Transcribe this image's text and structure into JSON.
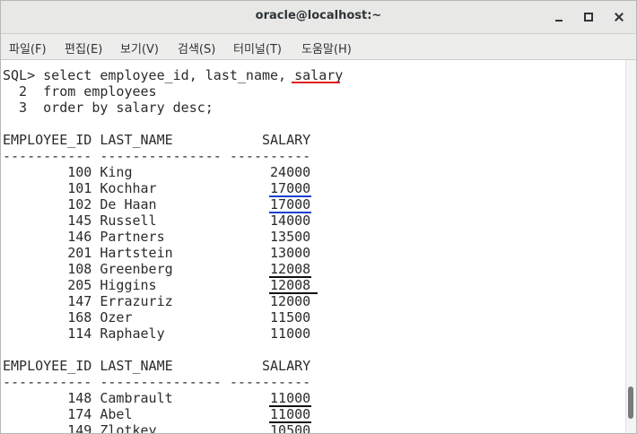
{
  "window": {
    "title": "oracle@localhost:~"
  },
  "menu": [
    "파일(F)",
    "편집(E)",
    "보기(V)",
    "검색(S)",
    "터미널(T)",
    "도움말(H)"
  ],
  "terminal": {
    "lines": [
      "SQL> select employee_id, last_name, salary",
      "  2  from employees",
      "  3  order by salary desc;",
      "",
      "EMPLOYEE_ID LAST_NAME           SALARY",
      "----------- --------------- ----------",
      "        100 King                 24000",
      "        101 Kochhar              17000",
      "        102 De Haan              17000",
      "        145 Russell              14000",
      "        146 Partners             13500",
      "        201 Hartstein            13000",
      "        108 Greenberg            12008",
      "        205 Higgins              12008",
      "        147 Errazuriz            12000",
      "        168 Ozer                 11500",
      "        114 Raphaely             11000",
      "",
      "EMPLOYEE_ID LAST_NAME           SALARY",
      "----------- --------------- ----------",
      "        148 Cambrault            11000",
      "        174 Abel                 11000",
      "        149 Zlotkey              10500"
    ]
  },
  "annotation_colors": {
    "red": "#e01b24",
    "blue": "#1c3fd0",
    "black": "#111111"
  }
}
